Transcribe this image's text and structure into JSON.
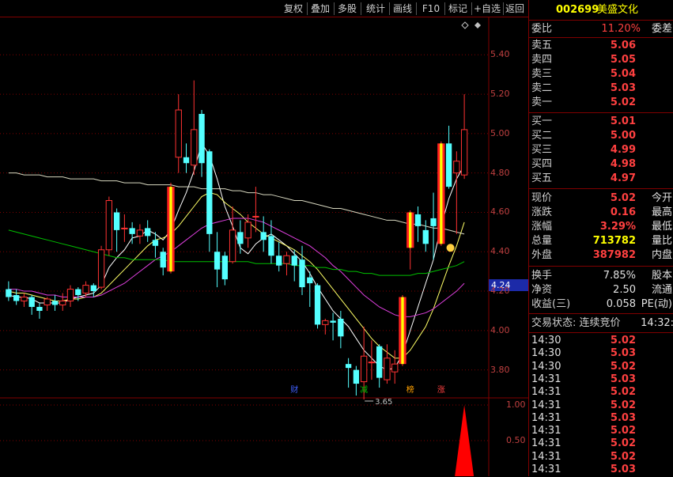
{
  "toolbar": {
    "buttons": [
      "复权",
      "叠加",
      "多股",
      "统计",
      "画线",
      "F10",
      "标记",
      "+自选",
      "返回"
    ]
  },
  "chart_data": {
    "type": "candlestick",
    "price_axis": {
      "ticks": [
        "5.40",
        "5.20",
        "5.00",
        "4.80",
        "4.60",
        "4.40",
        "4.20",
        "4.00",
        "3.80"
      ],
      "ylim": [
        3.67,
        5.59
      ]
    },
    "current_price_tag": "4.24",
    "low_marker": "3.65",
    "candles": [
      {
        "o": 4.21,
        "c": 4.17,
        "h": 4.25,
        "l": 4.15
      },
      {
        "o": 4.18,
        "c": 4.15,
        "h": 4.21,
        "l": 4.13
      },
      {
        "o": 4.15,
        "c": 4.17,
        "h": 4.19,
        "l": 4.12
      },
      {
        "o": 4.17,
        "c": 4.12,
        "h": 4.18,
        "l": 4.08
      },
      {
        "o": 4.12,
        "c": 4.1,
        "h": 4.14,
        "l": 4.06
      },
      {
        "o": 4.13,
        "c": 4.16,
        "h": 4.17,
        "l": 4.1
      },
      {
        "o": 4.15,
        "c": 4.13,
        "h": 4.18,
        "l": 4.1
      },
      {
        "o": 4.13,
        "c": 4.15,
        "h": 4.19,
        "l": 4.1
      },
      {
        "o": 4.15,
        "c": 4.21,
        "h": 4.23,
        "l": 4.12
      },
      {
        "o": 4.21,
        "c": 4.18,
        "h": 4.22,
        "l": 4.15
      },
      {
        "o": 4.19,
        "c": 4.23,
        "h": 4.25,
        "l": 4.17
      },
      {
        "o": 4.23,
        "c": 4.2,
        "h": 4.24,
        "l": 4.17
      },
      {
        "o": 4.22,
        "c": 4.41,
        "h": 4.43,
        "l": 4.21
      },
      {
        "o": 4.41,
        "c": 4.66,
        "h": 4.68,
        "l": 4.38
      },
      {
        "o": 4.6,
        "c": 4.51,
        "h": 4.62,
        "l": 4.4
      },
      {
        "o": 4.52,
        "c": 4.52,
        "h": 4.59,
        "l": 4.45
      },
      {
        "o": 4.52,
        "c": 4.49,
        "h": 4.55,
        "l": 4.44
      },
      {
        "o": 4.48,
        "c": 4.51,
        "h": 4.54,
        "l": 4.44
      },
      {
        "o": 4.52,
        "c": 4.48,
        "h": 4.56,
        "l": 4.45
      },
      {
        "o": 4.46,
        "c": 4.43,
        "h": 4.5,
        "l": 4.37
      },
      {
        "o": 4.4,
        "c": 4.32,
        "h": 4.42,
        "l": 4.28
      },
      {
        "o": 4.3,
        "c": 4.73,
        "h": 4.75,
        "l": 4.29
      },
      {
        "o": 4.88,
        "c": 5.12,
        "h": 5.2,
        "l": 4.8
      },
      {
        "o": 4.88,
        "c": 4.85,
        "h": 4.95,
        "l": 4.8
      },
      {
        "o": 4.84,
        "c": 5.02,
        "h": 5.27,
        "l": 4.79
      },
      {
        "o": 5.1,
        "c": 4.85,
        "h": 5.12,
        "l": 4.78
      },
      {
        "o": 4.91,
        "c": 4.49,
        "h": 4.92,
        "l": 4.4
      },
      {
        "o": 4.4,
        "c": 4.31,
        "h": 4.5,
        "l": 4.22
      },
      {
        "o": 4.38,
        "c": 4.26,
        "h": 4.4,
        "l": 4.23
      },
      {
        "o": 4.35,
        "c": 4.51,
        "h": 4.63,
        "l": 4.34
      },
      {
        "o": 4.5,
        "c": 4.44,
        "h": 4.56,
        "l": 4.39
      },
      {
        "o": 4.47,
        "c": 4.55,
        "h": 4.59,
        "l": 4.42
      },
      {
        "o": 4.58,
        "c": 4.58,
        "h": 4.73,
        "l": 4.5
      },
      {
        "o": 4.5,
        "c": 4.46,
        "h": 4.58,
        "l": 4.4
      },
      {
        "o": 4.48,
        "c": 4.38,
        "h": 4.56,
        "l": 4.34
      },
      {
        "o": 4.38,
        "c": 4.33,
        "h": 4.45,
        "l": 4.3
      },
      {
        "o": 4.34,
        "c": 4.38,
        "h": 4.4,
        "l": 4.28
      },
      {
        "o": 4.38,
        "c": 4.33,
        "h": 4.41,
        "l": 4.25
      },
      {
        "o": 4.36,
        "c": 4.22,
        "h": 4.43,
        "l": 4.18
      },
      {
        "o": 4.27,
        "c": 4.24,
        "h": 4.3,
        "l": 4.12
      },
      {
        "o": 4.23,
        "c": 4.03,
        "h": 4.24,
        "l": 4.01
      },
      {
        "o": 4.03,
        "c": 4.05,
        "h": 4.06,
        "l": 3.98
      },
      {
        "o": 4.05,
        "c": 4.04,
        "h": 4.09,
        "l": 3.95
      },
      {
        "o": 4.06,
        "c": 3.97,
        "h": 4.1,
        "l": 3.91
      },
      {
        "o": 3.83,
        "c": 3.81,
        "h": 3.86,
        "l": 3.71
      },
      {
        "o": 3.8,
        "c": 3.73,
        "h": 3.82,
        "l": 3.67
      },
      {
        "o": 3.74,
        "c": 3.87,
        "h": 4.02,
        "l": 3.65
      },
      {
        "o": 3.84,
        "c": 3.84,
        "h": 3.95,
        "l": 3.75
      },
      {
        "o": 3.92,
        "c": 3.76,
        "h": 3.93,
        "l": 3.71
      },
      {
        "o": 3.75,
        "c": 3.86,
        "h": 3.93,
        "l": 3.73
      },
      {
        "o": 3.79,
        "c": 3.83,
        "h": 3.9,
        "l": 3.73
      },
      {
        "o": 3.83,
        "c": 4.17,
        "h": 4.18,
        "l": 3.82
      },
      {
        "o": 4.42,
        "c": 4.6,
        "h": 4.61,
        "l": 4.31
      },
      {
        "o": 4.59,
        "c": 4.53,
        "h": 4.63,
        "l": 4.45
      },
      {
        "o": 4.51,
        "c": 4.44,
        "h": 4.56,
        "l": 4.4
      },
      {
        "o": 4.57,
        "c": 4.53,
        "h": 4.7,
        "l": 4.36
      },
      {
        "o": 4.44,
        "c": 4.95,
        "h": 4.96,
        "l": 4.43
      },
      {
        "o": 4.95,
        "c": 4.73,
        "h": 5.04,
        "l": 4.72
      },
      {
        "o": 4.8,
        "c": 4.86,
        "h": 4.91,
        "l": 4.49
      },
      {
        "o": 4.79,
        "c": 5.02,
        "h": 5.2,
        "l": 4.77
      }
    ],
    "limit_up_indices": [
      21,
      51,
      52,
      56
    ],
    "ma_lines": [
      {
        "color": "#ffffff",
        "values": [
          4.18,
          4.17,
          4.17,
          4.16,
          4.14,
          4.14,
          4.14,
          4.14,
          4.16,
          4.17,
          4.18,
          4.19,
          4.23,
          4.32,
          4.37,
          4.41,
          4.47,
          4.48,
          4.51,
          4.49,
          4.46,
          4.51,
          4.61,
          4.7,
          4.81,
          4.95,
          4.89,
          4.77,
          4.63,
          4.53,
          4.42,
          4.39,
          4.44,
          4.47,
          4.49,
          4.46,
          4.43,
          4.39,
          4.35,
          4.29,
          4.22,
          4.16,
          4.1,
          4.06,
          4.02,
          3.96,
          3.9,
          3.86,
          3.82,
          3.8,
          3.81,
          3.88,
          4.0,
          4.12,
          4.24,
          4.36,
          4.53,
          4.67,
          4.77,
          4.84
        ]
      },
      {
        "color": "#ffff66",
        "values": [
          4.2,
          4.19,
          4.19,
          4.18,
          4.17,
          4.16,
          4.15,
          4.15,
          4.16,
          4.16,
          4.17,
          4.17,
          4.19,
          4.23,
          4.27,
          4.31,
          4.35,
          4.39,
          4.43,
          4.46,
          4.47,
          4.49,
          4.53,
          4.58,
          4.63,
          4.68,
          4.7,
          4.69,
          4.65,
          4.62,
          4.59,
          4.55,
          4.52,
          4.49,
          4.47,
          4.45,
          4.43,
          4.41,
          4.38,
          4.35,
          4.31,
          4.26,
          4.21,
          4.16,
          4.11,
          4.06,
          4.01,
          3.96,
          3.92,
          3.89,
          3.86,
          3.86,
          3.9,
          3.96,
          4.02,
          4.11,
          4.22,
          4.33,
          4.43,
          4.55
        ]
      },
      {
        "color": "#e040e0",
        "values": [
          4.21,
          4.21,
          4.2,
          4.2,
          4.19,
          4.18,
          4.18,
          4.17,
          4.17,
          4.17,
          4.17,
          4.17,
          4.18,
          4.2,
          4.22,
          4.24,
          4.27,
          4.3,
          4.33,
          4.36,
          4.38,
          4.4,
          4.43,
          4.46,
          4.49,
          4.52,
          4.54,
          4.55,
          4.56,
          4.57,
          4.57,
          4.57,
          4.56,
          4.55,
          4.53,
          4.51,
          4.49,
          4.47,
          4.45,
          4.43,
          4.4,
          4.37,
          4.33,
          4.3,
          4.26,
          4.22,
          4.18,
          4.15,
          4.12,
          4.1,
          4.08,
          4.07,
          4.07,
          4.08,
          4.09,
          4.11,
          4.14,
          4.17,
          4.2,
          4.24
        ]
      },
      {
        "color": "#00c000",
        "values": [
          4.51,
          4.5,
          4.49,
          4.48,
          4.47,
          4.46,
          4.45,
          4.44,
          4.43,
          4.42,
          4.41,
          4.4,
          4.39,
          4.38,
          4.37,
          4.37,
          4.36,
          4.36,
          4.36,
          4.36,
          4.36,
          4.35,
          4.35,
          4.35,
          4.35,
          4.35,
          4.35,
          4.35,
          4.35,
          4.35,
          4.35,
          4.35,
          4.34,
          4.34,
          4.34,
          4.34,
          4.34,
          4.33,
          4.33,
          4.33,
          4.32,
          4.32,
          4.31,
          4.31,
          4.3,
          4.3,
          4.29,
          4.29,
          4.28,
          4.28,
          4.28,
          4.28,
          4.28,
          4.29,
          4.29,
          4.3,
          4.31,
          4.32,
          4.33,
          4.35
        ]
      },
      {
        "color": "#d8d8c0",
        "values": [
          4.8,
          4.8,
          4.79,
          4.79,
          4.79,
          4.78,
          4.78,
          4.78,
          4.77,
          4.77,
          4.77,
          4.77,
          4.76,
          4.76,
          4.76,
          4.75,
          4.75,
          4.75,
          4.74,
          4.74,
          4.74,
          4.74,
          4.73,
          4.73,
          4.73,
          4.72,
          4.72,
          4.72,
          4.72,
          4.71,
          4.71,
          4.7,
          4.7,
          4.69,
          4.69,
          4.68,
          4.67,
          4.66,
          4.66,
          4.65,
          4.64,
          4.63,
          4.62,
          4.62,
          4.61,
          4.6,
          4.59,
          4.58,
          4.57,
          4.56,
          4.56,
          4.55,
          4.54,
          4.54,
          4.53,
          4.52,
          4.52,
          4.51,
          4.5,
          4.49
        ]
      }
    ],
    "event_badges": [
      {
        "index": 37,
        "text": "财",
        "color": "#4060ff"
      },
      {
        "index": 46,
        "text": "减",
        "color": "#00c000"
      },
      {
        "index": 52,
        "text": "榜",
        "color": "#ffa000"
      },
      {
        "index": 56,
        "text": "涨",
        "color": "#ff4040"
      }
    ],
    "indicator": {
      "ticks": [
        "1.00",
        "0.50"
      ],
      "ylim": [
        0,
        1.1
      ],
      "spike_index": 59,
      "spike_value": 1.0
    }
  },
  "quote": {
    "code": "002699",
    "name": "美盛文化",
    "weibi_label": "委比",
    "weibi_value": "11.20%",
    "weicha_label": "委差",
    "asks": [
      {
        "label": "卖五",
        "price": "5.06"
      },
      {
        "label": "卖四",
        "price": "5.05"
      },
      {
        "label": "卖三",
        "price": "5.04"
      },
      {
        "label": "卖二",
        "price": "5.03"
      },
      {
        "label": "卖一",
        "price": "5.02"
      }
    ],
    "bids": [
      {
        "label": "买一",
        "price": "5.01"
      },
      {
        "label": "买二",
        "price": "5.00"
      },
      {
        "label": "买三",
        "price": "4.99"
      },
      {
        "label": "买四",
        "price": "4.98"
      },
      {
        "label": "买五",
        "price": "4.97"
      }
    ],
    "stats": [
      {
        "l": "现价",
        "v": "5.02",
        "r": "今开",
        "c": "red"
      },
      {
        "l": "涨跌",
        "v": "0.16",
        "r": "最高",
        "c": "red"
      },
      {
        "l": "涨幅",
        "v": "3.29%",
        "r": "最低",
        "c": "red"
      },
      {
        "l": "总量",
        "v": "713782",
        "r": "量比",
        "c": "yel"
      },
      {
        "l": "外盘",
        "v": "387982",
        "r": "内盘",
        "c": "red"
      }
    ],
    "stats2": [
      {
        "l": "换手",
        "v": "7.85%",
        "r": "股本",
        "c": "white"
      },
      {
        "l": "净资",
        "v": "2.50",
        "r": "流通",
        "c": "white"
      },
      {
        "l": "收益(三)",
        "v": "0.058",
        "r": "PE(动)",
        "c": "white"
      }
    ],
    "status_label": "交易状态: 连续竞价",
    "status_time": "14:32:",
    "ticks": [
      {
        "t": "14:30",
        "p": "5.02"
      },
      {
        "t": "14:30",
        "p": "5.03"
      },
      {
        "t": "14:30",
        "p": "5.02"
      },
      {
        "t": "14:31",
        "p": "5.03"
      },
      {
        "t": "14:31",
        "p": "5.02"
      },
      {
        "t": "14:31",
        "p": "5.02"
      },
      {
        "t": "14:31",
        "p": "5.03"
      },
      {
        "t": "14:31",
        "p": "5.02"
      },
      {
        "t": "14:31",
        "p": "5.02"
      },
      {
        "t": "14:31",
        "p": "5.02"
      },
      {
        "t": "14:31",
        "p": "5.03"
      }
    ]
  }
}
